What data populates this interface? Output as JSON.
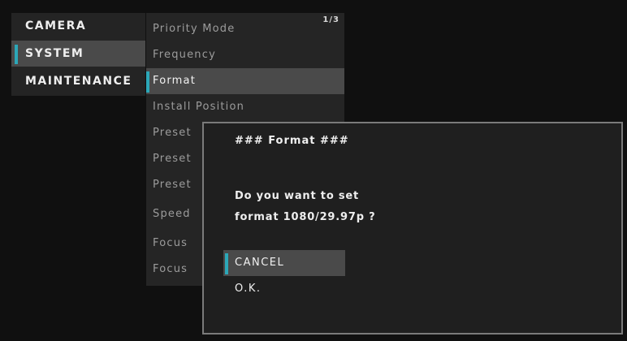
{
  "menu": {
    "categories": [
      {
        "label": "CAMERA",
        "selected": false
      },
      {
        "label": "SYSTEM",
        "selected": true
      },
      {
        "label": "MAINTENANCE",
        "selected": false
      }
    ]
  },
  "submenu": {
    "page_indicator": "1/3",
    "items": [
      {
        "label": "Priority Mode",
        "selected": false
      },
      {
        "label": "Frequency",
        "selected": false
      },
      {
        "label": "Format",
        "selected": true
      },
      {
        "label": "Install Position",
        "selected": false
      },
      {
        "label": "Preset",
        "selected": false
      },
      {
        "label": "Preset",
        "selected": false
      },
      {
        "label": "Preset",
        "selected": false
      },
      {
        "label": "Speed",
        "selected": false
      },
      {
        "label": "Focus",
        "selected": false
      },
      {
        "label": "Focus",
        "selected": false
      }
    ]
  },
  "dialog": {
    "title": "### Format ###",
    "message_line1": "Do you want to set",
    "message_line2": "format 1080/29.97p ?",
    "cancel_label": "CANCEL",
    "ok_label": "O.K.",
    "selected_option": "CANCEL"
  },
  "colors": {
    "accent": "#2ca7b8",
    "highlight": "#4a4a4a",
    "panel": "#252525",
    "background": "#101010"
  }
}
